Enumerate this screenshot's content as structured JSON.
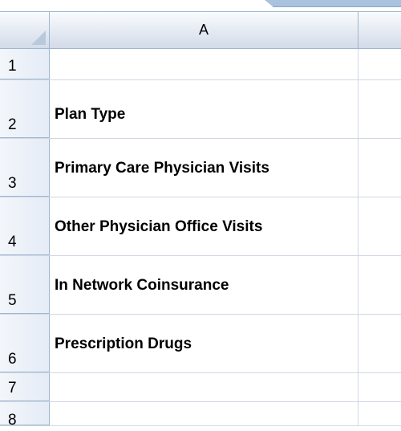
{
  "spreadsheet": {
    "column_headers": [
      "A"
    ],
    "rows": [
      {
        "number": "1",
        "a": ""
      },
      {
        "number": "2",
        "a": "Plan Type"
      },
      {
        "number": "3",
        "a": "Primary Care Physician Visits"
      },
      {
        "number": "4",
        "a": "Other Physician Office Visits"
      },
      {
        "number": "5",
        "a": "In Network Coinsurance"
      },
      {
        "number": "6",
        "a": "Prescription Drugs"
      },
      {
        "number": "7",
        "a": ""
      },
      {
        "number": "8",
        "a": ""
      }
    ]
  },
  "colors": {
    "header_border": "#9eb6ce",
    "grid_line": "#d0d7e5",
    "header_gradient_top": "#f9fcfd",
    "header_gradient_bottom": "#d3dbe9"
  }
}
